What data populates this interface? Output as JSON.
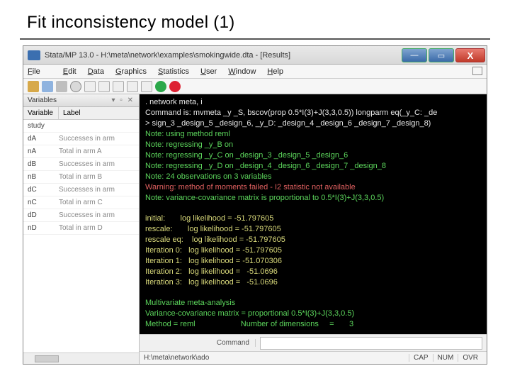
{
  "slide": {
    "title": "Fit inconsistency model (1)"
  },
  "window": {
    "title": "Stata/MP 13.0 - H:\\meta\\network\\examples\\smokingwide.dta - [Results]"
  },
  "menu": {
    "file": "File",
    "edit": "Edit",
    "data": "Data",
    "graphics": "Graphics",
    "statistics": "Statistics",
    "user": "User",
    "window": "Window",
    "help": "Help"
  },
  "winbtns": {
    "min": "—",
    "max": "▭",
    "close": "X"
  },
  "panel": {
    "title": "Variables",
    "head_var": "Variable",
    "head_lab": "Label",
    "rows": [
      {
        "v": "study",
        "l": ""
      },
      {
        "v": "dA",
        "l": "Successes in arm"
      },
      {
        "v": "nA",
        "l": "Total in arm A"
      },
      {
        "v": "dB",
        "l": "Successes in arm"
      },
      {
        "v": "nB",
        "l": "Total in arm B"
      },
      {
        "v": "dC",
        "l": "Successes in arm"
      },
      {
        "v": "nC",
        "l": "Total in arm C"
      },
      {
        "v": "dD",
        "l": "Successes in arm"
      },
      {
        "v": "nD",
        "l": "Total in arm D"
      }
    ]
  },
  "cmd": {
    "label": "Command"
  },
  "status": {
    "path": "H:\\meta\\network\\ado",
    "cap": "CAP",
    "num": "NUM",
    "ovr": "OVR"
  },
  "results": {
    "l01": ". network meta, i",
    "l02": "Command is: mvmeta _y _S, bscov(prop 0.5*I(3)+J(3,3,0.5)) longparm eq(_y_C: _de",
    "l03": "> sign_3 _design_5 _design_6, _y_D: _design_4 _design_6 _design_7 _design_8)",
    "l04": "Note: using method reml",
    "l05": "Note: regressing _y_B on",
    "l06": "Note: regressing _y_C on _design_3 _design_5 _design_6",
    "l07": "Note: regressing _y_D on _design_4 _design_6 _design_7 _design_8",
    "l08": "Note: 24 observations on 3 variables",
    "l09": "Warning: method of moments failed - I2 statistic not available",
    "l10": "Note: variance-covariance matrix is proportional to 0.5*I(3)+J(3,3,0.5)",
    "l11": "initial:       log likelihood = -51.797605",
    "l12": "rescale:       log likelihood = -51.797605",
    "l13": "rescale eq:    log likelihood = -51.797605",
    "l14": "Iteration 0:   log likelihood = -51.797605",
    "l15": "Iteration 1:   log likelihood = -51.070306",
    "l16": "Iteration 2:   log likelihood =   -51.0696",
    "l17": "Iteration 3:   log likelihood =   -51.0696",
    "l18": "Multivariate meta-analysis",
    "l19": "Variance-covariance matrix = proportional 0.5*I(3)+J(3,3,0.5)",
    "l20": "Method = reml                     Number of dimensions     =       3"
  }
}
